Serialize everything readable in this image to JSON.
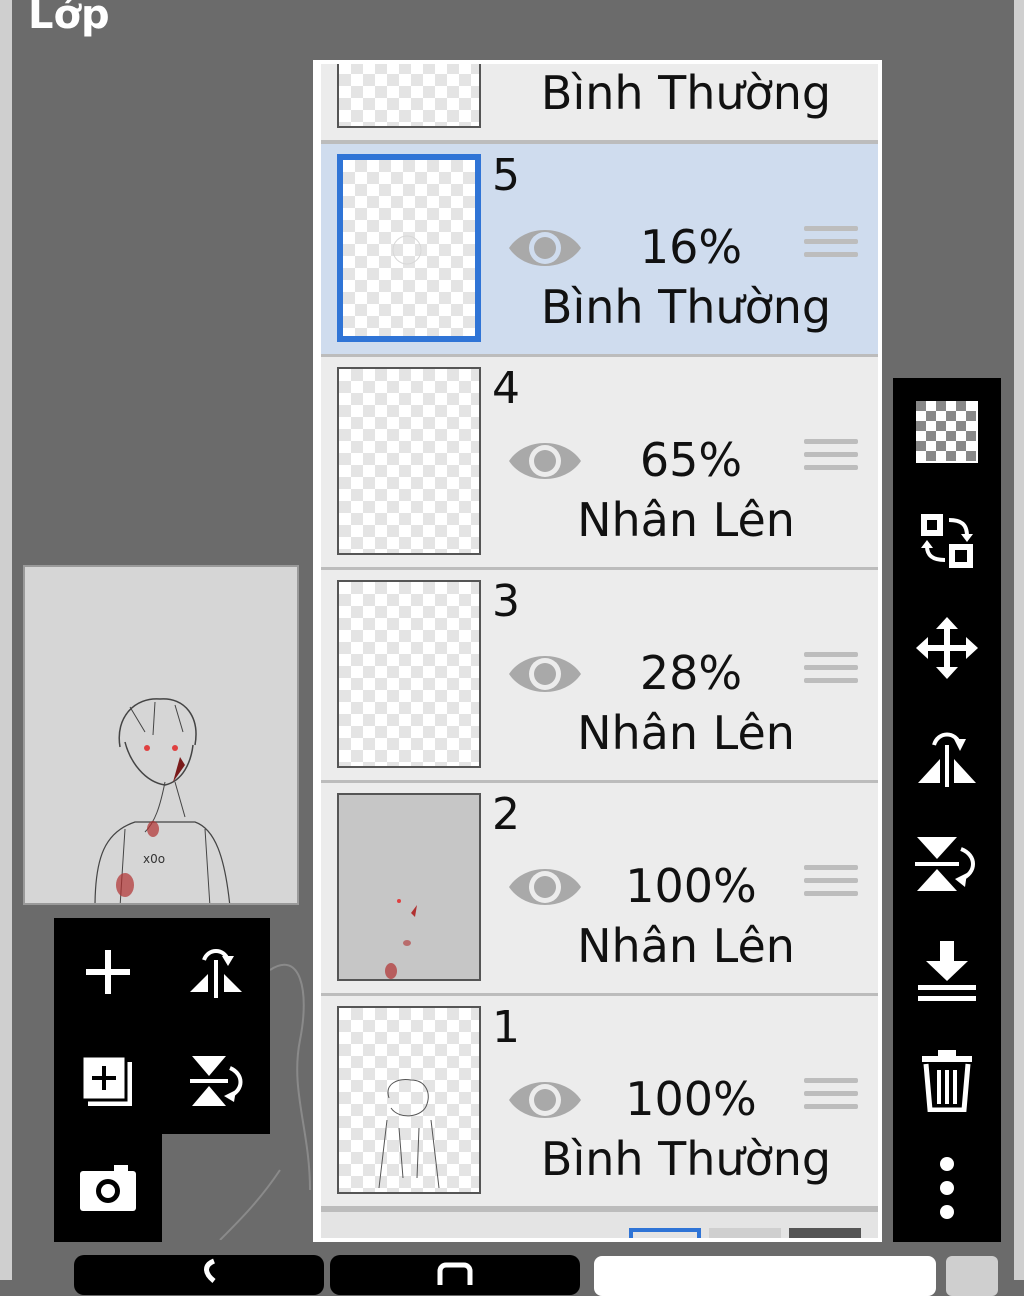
{
  "header": {
    "title": "Lớp"
  },
  "layers": [
    {
      "number": "",
      "opacity": "",
      "blend": "Bình Thường",
      "visible": true,
      "selected": false
    },
    {
      "number": "5",
      "opacity": "16%",
      "blend": "Bình Thường",
      "visible": true,
      "selected": true
    },
    {
      "number": "4",
      "opacity": "65%",
      "blend": "Nhân Lên",
      "visible": true,
      "selected": false
    },
    {
      "number": "3",
      "opacity": "28%",
      "blend": "Nhân Lên",
      "visible": true,
      "selected": false
    },
    {
      "number": "2",
      "opacity": "100%",
      "blend": "Nhân Lên",
      "visible": true,
      "selected": false
    },
    {
      "number": "1",
      "opacity": "100%",
      "blend": "Bình Thường",
      "visible": true,
      "selected": false
    }
  ],
  "left_tools": [
    "add-layer-icon",
    "flip-horizontal-rotate-icon",
    "duplicate-layer-icon",
    "flip-vertical-rotate-icon",
    "camera-icon"
  ],
  "right_tools": [
    "transparency-icon",
    "swap-layers-icon",
    "move-icon",
    "flip-horizontal-icon",
    "flip-vertical-icon",
    "merge-down-icon",
    "trash-icon",
    "more-vertical-icon"
  ],
  "colors": {
    "selected_row": "#cfdcee",
    "selected_border": "#2f74d6",
    "panel_bg": "#ececec",
    "toolbar_bg": "#000000"
  }
}
